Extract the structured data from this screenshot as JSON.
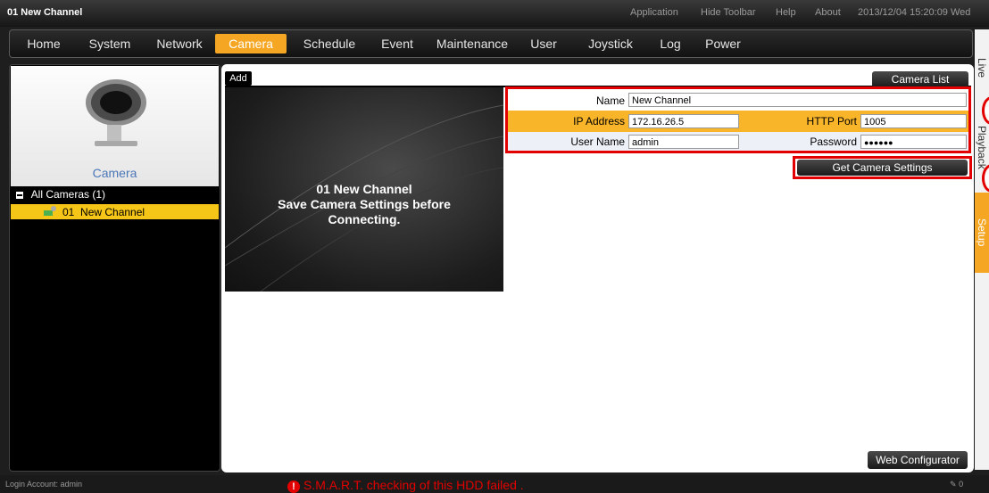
{
  "window": {
    "title": "01 New Channel"
  },
  "toolbar": {
    "links": [
      "Application",
      "Hide Toolbar",
      "Help",
      "About"
    ],
    "datetime": "2013/12/04 15:20:09 Wed"
  },
  "nav": {
    "items": [
      "Home",
      "System",
      "Network",
      "Camera",
      "Schedule",
      "Event",
      "Maintenance",
      "User",
      "Joystick",
      "Log",
      "Power"
    ],
    "active": "Camera"
  },
  "sidebar": {
    "heading": "Camera",
    "tree_root": "All Cameras (1)",
    "tree_items": [
      {
        "number": "01",
        "name": "New Channel"
      }
    ]
  },
  "main": {
    "tab_label": "Add",
    "camera_list_button": "Camera List",
    "preview": {
      "title": "01 New Channel",
      "message_line1": "Save Camera Settings before",
      "message_line2": "Connecting."
    },
    "form": {
      "name_label": "Name",
      "name_value": "New Channel",
      "ip_label": "IP Address",
      "ip_value": "172.16.26.5",
      "http_port_label": "HTTP Port",
      "http_port_value": "1005",
      "username_label": "User Name",
      "username_value": "admin",
      "password_label": "Password",
      "password_value": "●●●●●●"
    },
    "get_settings_button": "Get Camera Settings",
    "web_configurator_button": "Web Configurator"
  },
  "side_tabs": [
    "Live",
    "Playback",
    "Setup"
  ],
  "footer": {
    "login": "Login Account: admin",
    "alert": "S.M.A.R.T. checking of this HDD failed .",
    "counter": "0"
  },
  "colors": {
    "accent": "#f5a623",
    "alert": "#e30000",
    "selection": "#f5c518",
    "link": "#4a77b8"
  }
}
